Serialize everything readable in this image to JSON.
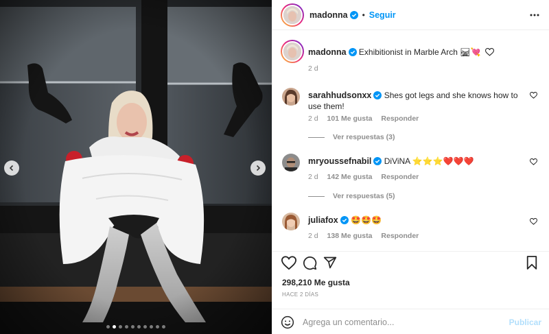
{
  "post": {
    "author": "madonna",
    "follow_label": "Seguir",
    "separator": "•",
    "caption": "Exhibitionist in Marble Arch 🛤💘",
    "caption_time": "2 d",
    "likes_text": "298,210 Me gusta",
    "posted_ago": "HACE 2 DÍAS",
    "carousel": {
      "slide_count": 10,
      "active_slide": 2
    }
  },
  "comments": [
    {
      "username": "sarahhudsonxx",
      "text": "Shes got legs and she knows how to use them!",
      "time": "2 d",
      "likes": "101 Me gusta",
      "reply_label": "Responder",
      "view_replies": "Ver respuestas (3)"
    },
    {
      "username": "mryoussefnabil",
      "text": "DiViNA ⭐⭐⭐❤️❤️❤️",
      "time": "2 d",
      "likes": "142 Me gusta",
      "reply_label": "Responder",
      "view_replies": "Ver respuestas (5)"
    },
    {
      "username": "juliafox",
      "text": "🤩🤩🤩",
      "time": "2 d",
      "likes": "138 Me gusta",
      "reply_label": "Responder"
    }
  ],
  "composer": {
    "placeholder": "Agrega un comentario...",
    "publish_label": "Publicar"
  },
  "icons": {
    "more": "more-options-icon",
    "verified": "verified-badge-icon",
    "like": "heart-icon",
    "comment": "comment-icon",
    "share": "paper-plane-icon",
    "save": "bookmark-icon",
    "emoji": "emoji-icon",
    "prev": "chevron-left-icon",
    "next": "chevron-right-icon"
  },
  "colors": {
    "accent": "#0095f6",
    "publish_disabled": "#b2dffc",
    "muted": "#8e8e8e",
    "text": "#262626",
    "verified": "#0095f6"
  }
}
